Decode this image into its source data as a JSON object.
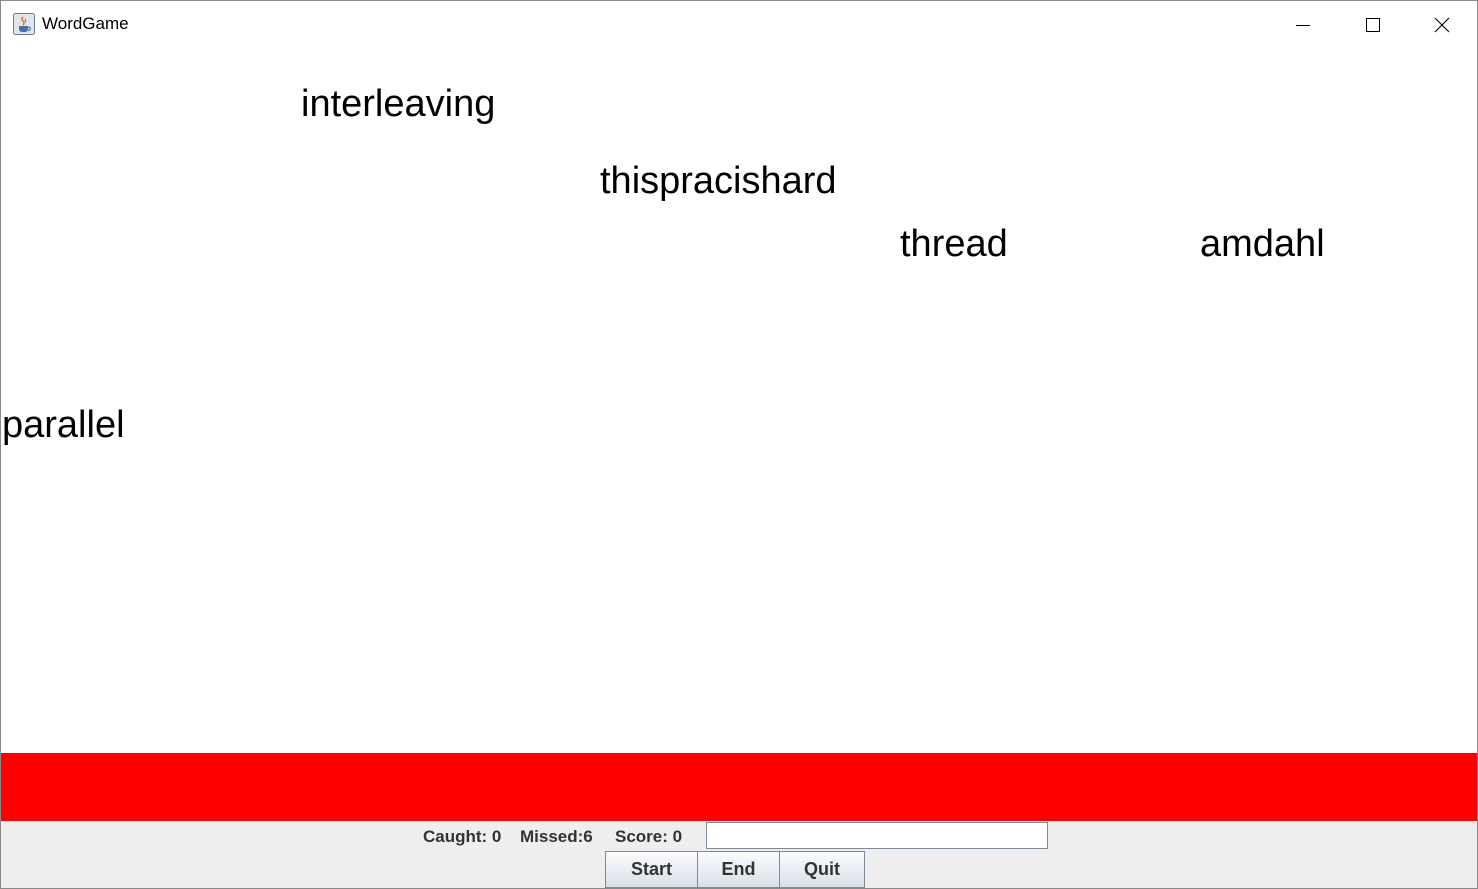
{
  "window": {
    "title": "WordGame",
    "icons": {
      "app": "java-cup-icon",
      "minimize": "minimize-icon",
      "maximize": "maximize-icon",
      "close": "close-icon"
    }
  },
  "game": {
    "falling_words": [
      "interleaving",
      "thispracishard",
      "thread",
      "amdahl",
      "parallel"
    ],
    "danger_zone_color": "#ff0000"
  },
  "controls": {
    "caught_label": "Caught: 0",
    "missed_label": "Missed:6",
    "score_label": "Score: 0",
    "input_value": "",
    "start_label": "Start",
    "end_label": "End",
    "quit_label": "Quit"
  }
}
